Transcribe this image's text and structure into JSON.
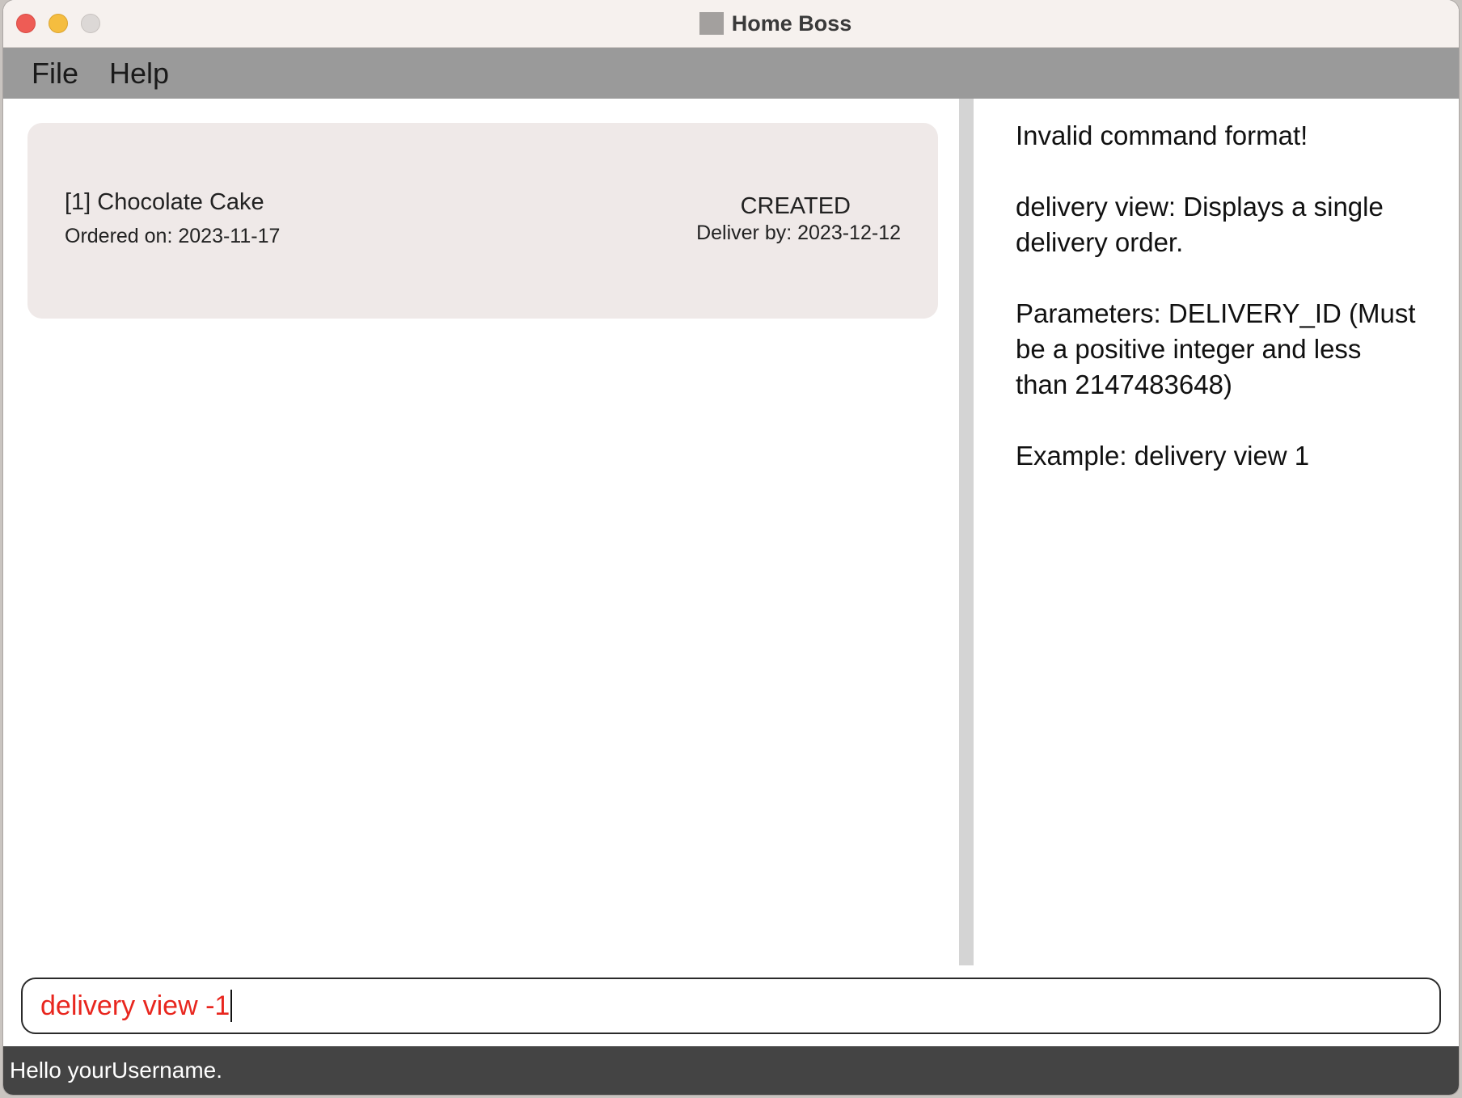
{
  "window": {
    "title": "Home Boss"
  },
  "menu": {
    "items": [
      {
        "label": "File"
      },
      {
        "label": "Help"
      }
    ]
  },
  "delivery_list": {
    "items": [
      {
        "title": "[1] Chocolate Cake",
        "ordered_on": "Ordered on: 2023-11-17",
        "status": "CREATED",
        "deliver_by": "Deliver by: 2023-12-12"
      }
    ]
  },
  "result_display": {
    "text": "Invalid command format!\n\ndelivery view: Displays a single delivery order.\n\nParameters: DELIVERY_ID (Must be a positive integer and less than 2147483648)\n\nExample: delivery view 1"
  },
  "command_box": {
    "value": "delivery view -1",
    "text_color": "#e8261e"
  },
  "status_bar": {
    "text": "Hello yourUsername."
  },
  "colors": {
    "menubar": "#9a9a9a",
    "card_bg": "#efe9e8",
    "statusbar": "#444444",
    "error_text": "#e8261e"
  },
  "icons": {
    "app_icon": "home-boss-app-icon"
  }
}
